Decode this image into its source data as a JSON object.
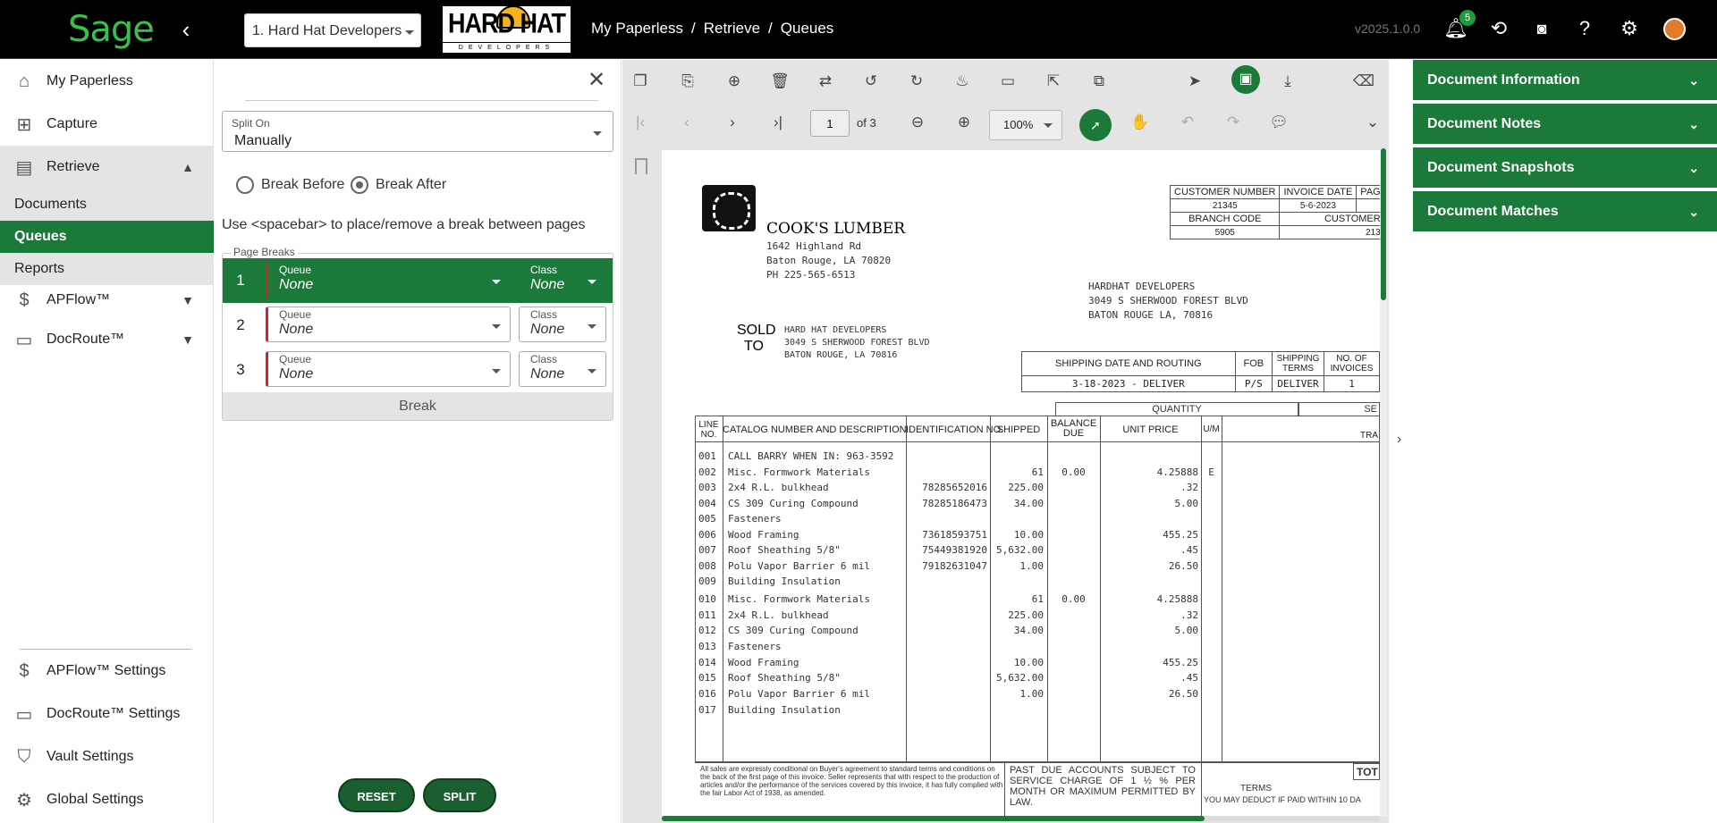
{
  "header": {
    "app_logo": "Sage",
    "company": "1. Hard Hat Developers",
    "company_logo_word": "HARD HAT",
    "company_logo_sub": "DEVELOPERS",
    "breadcrumb": [
      "My Paperless",
      "Retrieve",
      "Queues"
    ],
    "version": "v2025.1.0.0",
    "notification_count": "5",
    "icons": [
      "bell-icon",
      "history-icon",
      "rss-icon",
      "help-icon",
      "alert-icon",
      "user-avatar"
    ]
  },
  "sidebar": {
    "items": [
      {
        "label": "My Paperless",
        "icon": "home-icon"
      },
      {
        "label": "Capture",
        "icon": "capture-icon"
      },
      {
        "label": "Retrieve",
        "icon": "retrieve-icon"
      },
      {
        "label": "APFlow™",
        "icon": "apflow-icon"
      },
      {
        "label": "DocRoute™",
        "icon": "folder-icon"
      }
    ],
    "retrieve_sub": [
      "Documents",
      "Queues",
      "Reports"
    ],
    "settings": [
      {
        "label": "APFlow™ Settings",
        "icon": "apflow-icon"
      },
      {
        "label": "DocRoute™ Settings",
        "icon": "folder-icon"
      },
      {
        "label": "Vault Settings",
        "icon": "shield-icon"
      },
      {
        "label": "Global Settings",
        "icon": "gear-icon"
      }
    ]
  },
  "split_panel": {
    "split_on_label": "Split On",
    "split_on_value": "Manually",
    "break_before": "Break Before",
    "break_after": "Break After",
    "hint": "Use <spacebar> to place/remove a break between pages",
    "page_breaks_label": "Page Breaks",
    "queue_label": "Queue",
    "class_label": "Class",
    "rows": [
      {
        "num": "1",
        "queue": "None",
        "class": "None"
      },
      {
        "num": "2",
        "queue": "None",
        "class": "None"
      },
      {
        "num": "3",
        "queue": "None",
        "class": "None"
      }
    ],
    "break_label": "Break",
    "reset": "RESET",
    "split": "SPLIT"
  },
  "viewer": {
    "page": "1",
    "of_pages": "of 3",
    "zoom": "100%"
  },
  "invoice": {
    "company": "COOK'S LUMBER",
    "address": [
      "1642 Highland Rd",
      "Baton Rouge, LA 70820",
      "PH 225-565-6513"
    ],
    "cust_headers": [
      "CUSTOMER NUMBER",
      "INVOICE DATE",
      "PAG"
    ],
    "cust_values": [
      "21345",
      "5-6-2023"
    ],
    "branch_headers": [
      "BRANCH CODE",
      "CUSTOMER"
    ],
    "branch_values": [
      "5905",
      "213"
    ],
    "ship_to": [
      "HARDHAT DEVELOPERS",
      "3049 S SHERWOOD FOREST BLVD",
      "BATON ROUGE LA, 70816"
    ],
    "sold_to_label": [
      "SOLD",
      "TO"
    ],
    "sold_to": [
      "HARD HAT DEVELOPERS",
      "3049 S SHERWOOD FOREST BLVD",
      "BATON ROUGE, LA 70816"
    ],
    "ship_headers": [
      "SHIPPING DATE AND ROUTING",
      "FOB",
      "SHIPPING TERMS",
      "NO. OF INVOICES"
    ],
    "ship_values": [
      "3-18-2023 - DELIVER",
      "P/S",
      "DELIVER",
      "1"
    ],
    "quantity_label": "QUANTITY",
    "se_label": "SE",
    "col_headers": [
      "LINE NO.",
      "CATALOG NUMBER AND DESCRIPTION",
      "IDENTIFICATION NO.",
      "SHIPPED",
      "BALANCE DUE",
      "UNIT PRICE",
      "U/M",
      "TRA"
    ],
    "lines": [
      {
        "no": "001",
        "desc": "CALL BARRY WHEN IN: 963-3592",
        "id": "",
        "shipped": "",
        "bal": "",
        "price": "",
        "um": ""
      },
      {
        "no": "002",
        "desc": "Misc. Formwork Materials",
        "id": "",
        "shipped": "61",
        "bal": "0.00",
        "price": "4.25888",
        "um": "E"
      },
      {
        "no": "003",
        "desc": "2x4 R.L. bulkhead",
        "id": "78285652016",
        "shipped": "225.00",
        "bal": "",
        "price": ".32",
        "um": ""
      },
      {
        "no": "004",
        "desc": "CS 309 Curing Compound",
        "id": "78285186473",
        "shipped": "34.00",
        "bal": "",
        "price": "5.00",
        "um": ""
      },
      {
        "no": "005",
        "desc": "Fasteners",
        "id": "",
        "shipped": "",
        "bal": "",
        "price": "",
        "um": ""
      },
      {
        "no": "006",
        "desc": "Wood Framing",
        "id": "73618593751",
        "shipped": "10.00",
        "bal": "",
        "price": "455.25",
        "um": ""
      },
      {
        "no": "007",
        "desc": "Roof Sheathing 5/8\"",
        "id": "75449381920",
        "shipped": "5,632.00",
        "bal": "",
        "price": ".45",
        "um": ""
      },
      {
        "no": "008",
        "desc": "Polu Vapor Barrier 6 mil",
        "id": "79182631047",
        "shipped": "1.00",
        "bal": "",
        "price": "26.50",
        "um": ""
      },
      {
        "no": "009",
        "desc": "Building Insulation",
        "id": "",
        "shipped": "",
        "bal": "",
        "price": "",
        "um": ""
      },
      {
        "no": "010",
        "desc": "Misc. Formwork Materials",
        "id": "",
        "shipped": "61",
        "bal": "0.00",
        "price": "4.25888",
        "um": ""
      },
      {
        "no": "011",
        "desc": "2x4 R.L. bulkhead",
        "id": "",
        "shipped": "225.00",
        "bal": "",
        "price": ".32",
        "um": ""
      },
      {
        "no": "012",
        "desc": "CS 309 Curing Compound",
        "id": "",
        "shipped": "34.00",
        "bal": "",
        "price": "5.00",
        "um": ""
      },
      {
        "no": "013",
        "desc": "Fasteners",
        "id": "",
        "shipped": "",
        "bal": "",
        "price": "",
        "um": ""
      },
      {
        "no": "014",
        "desc": "Wood Framing",
        "id": "",
        "shipped": "10.00",
        "bal": "",
        "price": "455.25",
        "um": ""
      },
      {
        "no": "015",
        "desc": "Roof Sheathing 5/8\"",
        "id": "",
        "shipped": "5,632.00",
        "bal": "",
        "price": ".45",
        "um": ""
      },
      {
        "no": "016",
        "desc": "Polu Vapor Barrier 6 mil",
        "id": "",
        "shipped": "1.00",
        "bal": "",
        "price": "26.50",
        "um": ""
      },
      {
        "no": "017",
        "desc": "Building Insulation",
        "id": "",
        "shipped": "",
        "bal": "",
        "price": "",
        "um": ""
      }
    ],
    "footer_small": "All sales are expressly conditional on Buyer's agreement to standard terms and conditions on the back of the first page of this invoice. Seller represents that with respect to the production of articles and/or the performance of the services covered by this invoice, it has fully complied with the fair Labor Act of 1938, as amended.",
    "past_due": "PAST DUE ACCOUNTS SUBJECT TO SERVICE CHARGE OF 1 ½ % PER MONTH OR MAXIMUM PERMITTED BY LAW.",
    "terms_label": "TERMS",
    "deduct_note": "YOU MAY DEDUCT IF PAID WITHIN 10 DA",
    "tot_label": "TOT"
  },
  "right_panel": {
    "sections": [
      "Document Information",
      "Document Notes",
      "Document Snapshots",
      "Document Matches"
    ]
  },
  "colors": {
    "brand_green": "#1b7a3a",
    "sage_logo": "#36c24a",
    "required_marker": "#c42a2a"
  }
}
